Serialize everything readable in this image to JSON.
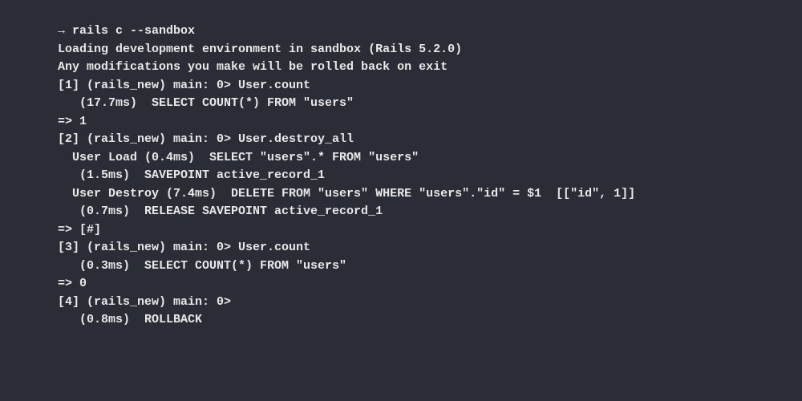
{
  "terminal": {
    "lines": [
      "→ rails c --sandbox",
      "Loading development environment in sandbox (Rails 5.2.0)",
      "Any modifications you make will be rolled back on exit",
      "[1] (rails_new) main: 0> User.count",
      "   (17.7ms)  SELECT COUNT(*) FROM \"users\"",
      "=> 1",
      "[2] (rails_new) main: 0> User.destroy_all",
      "  User Load (0.4ms)  SELECT \"users\".* FROM \"users\"",
      "   (1.5ms)  SAVEPOINT active_record_1",
      "  User Destroy (7.4ms)  DELETE FROM \"users\" WHERE \"users\".\"id\" = $1  [[\"id\", 1]]",
      "   (0.7ms)  RELEASE SAVEPOINT active_record_1",
      "=> [#]",
      "[3] (rails_new) main: 0> User.count",
      "   (0.3ms)  SELECT COUNT(*) FROM \"users\"",
      "=> 0",
      "[4] (rails_new) main: 0>",
      "   (0.8ms)  ROLLBACK"
    ]
  }
}
